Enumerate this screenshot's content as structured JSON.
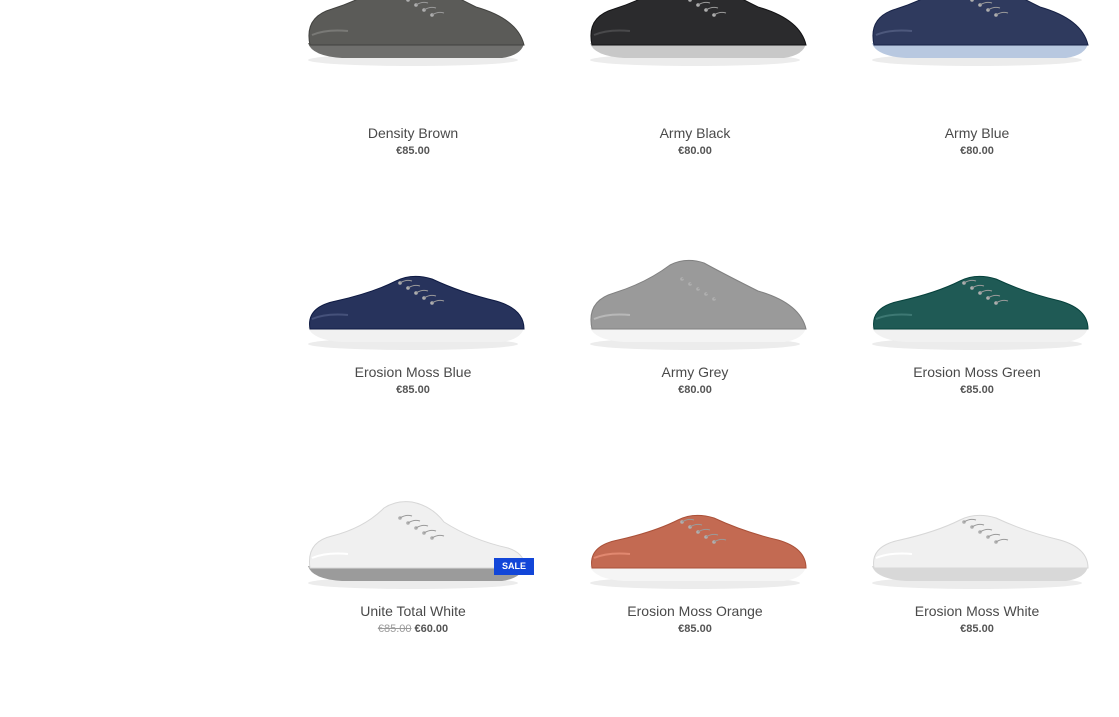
{
  "products": [
    {
      "name": "Density Brown",
      "price": "€85.00",
      "old_price": "",
      "sale_label": "",
      "color": "#5b5b58",
      "sole": "#6f6f6d",
      "style": "lace"
    },
    {
      "name": "Army Black",
      "price": "€80.00",
      "old_price": "",
      "sale_label": "",
      "color": "#2b2b2d",
      "sole": "#c8c8c8",
      "style": "lace"
    },
    {
      "name": "Army Blue",
      "price": "€80.00",
      "old_price": "",
      "sale_label": "",
      "color": "#2f3a5e",
      "sole": "#b8c8e0",
      "style": "lace"
    },
    {
      "name": "Erosion Moss Blue",
      "price": "€85.00",
      "old_price": "",
      "sale_label": "",
      "color": "#27335c",
      "sole": "#f1f1f1",
      "style": "moc"
    },
    {
      "name": "Army Grey",
      "price": "€80.00",
      "old_price": "",
      "sale_label": "",
      "color": "#9a9a9a",
      "sole": "#f4f4f4",
      "style": "lace"
    },
    {
      "name": "Erosion Moss Green",
      "price": "€85.00",
      "old_price": "",
      "sale_label": "",
      "color": "#1f5a55",
      "sole": "#f1f1f1",
      "style": "moc"
    },
    {
      "name": "Unite Total White",
      "price": "€60.00",
      "old_price": "€85.00",
      "sale_label": "SALE",
      "color": "#f0f0f0",
      "sole": "#9b9b9b",
      "style": "sock"
    },
    {
      "name": "Erosion Moss Orange",
      "price": "€85.00",
      "old_price": "",
      "sale_label": "",
      "color": "#c36a52",
      "sole": "#f5f5f5",
      "style": "moc"
    },
    {
      "name": "Erosion Moss White",
      "price": "€85.00",
      "old_price": "",
      "sale_label": "",
      "color": "#f0f0f0",
      "sole": "#d8d8d8",
      "style": "moc"
    }
  ]
}
